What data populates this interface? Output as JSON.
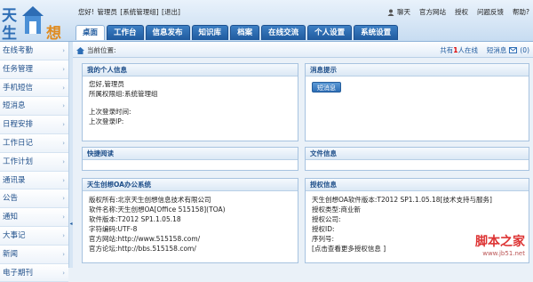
{
  "brand": {
    "logo_left_top": "天",
    "logo_left_bottom": "生",
    "logo_right": "想"
  },
  "greeting": [
    "您好!",
    "管理员",
    "[系统管理组]",
    "[退出]"
  ],
  "top_links": {
    "chat": "聊天",
    "site": "官方网站",
    "license": "授权",
    "feedback": "问题反馈",
    "help": "帮助?"
  },
  "tabs": [
    "桌面",
    "工作台",
    "信息发布",
    "知识库",
    "档案",
    "在线交流",
    "个人设置",
    "系统设置"
  ],
  "active_tab": 0,
  "subbar": {
    "location": "当前位置:",
    "online_pre": "共有",
    "online_num": "1",
    "online_post": "人在线",
    "sms_label": "短消息",
    "sms_count": "(0)"
  },
  "sidebar": [
    "在线考勤",
    "任务管理",
    "手机短信",
    "短消息",
    "日程安排",
    "工作日记",
    "工作计划",
    "通讯录",
    "公告",
    "通知",
    "大事记",
    "新闻",
    "电子期刊"
  ],
  "panels": {
    "my_info": {
      "title": "我的个人信息",
      "lines": [
        "您好,管理员",
        "所属权限组:系统管理组"
      ],
      "lines2": [
        "上次登录时间:",
        "上次登录IP:"
      ]
    },
    "msg": {
      "title": "消息提示",
      "button": "短消息"
    },
    "quick": {
      "title": "快捷阅读"
    },
    "files": {
      "title": "文件信息"
    },
    "system": {
      "title": "天生创想OA办公系统",
      "lines": [
        "版权所有:北京天生创想信息技术有限公司",
        "软件名称:天生创想OA[Office 515158](TOA)",
        "软件版本:T2012 SP1.1.05.18",
        "字符编码:UTF-8",
        "官方网站:http://www.515158.com/",
        "官方论坛:http://bbs.515158.com/"
      ]
    },
    "license": {
      "title": "授权信息",
      "lines": [
        "天生创想OA软件版本:T2012 SP1.1.05.18[技术支持与服务]",
        "授权类型:商业新",
        "授权公司:",
        "授权ID:",
        "序列号:",
        "[点击查看更多授权信息 ]"
      ]
    }
  },
  "watermark": {
    "line1": "脚本之家",
    "line2": "www.jb51.net"
  }
}
